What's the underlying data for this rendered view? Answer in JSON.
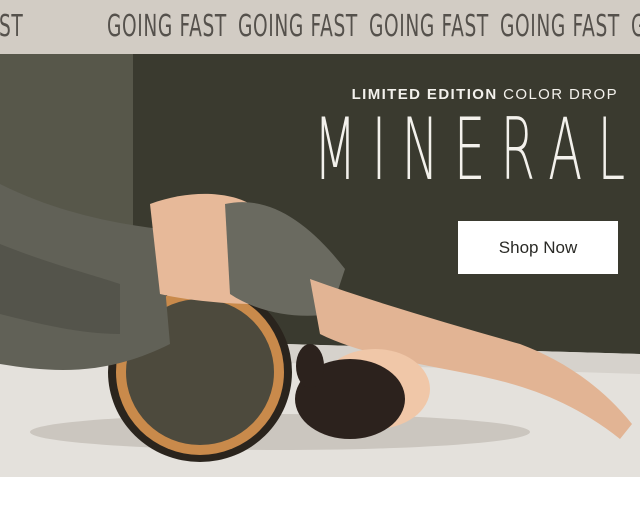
{
  "ticker": {
    "items": [
      "FAST",
      "GOING FAST",
      "GOING FAST",
      "GOING FAST",
      "GOING FAST",
      "GOING FAST"
    ]
  },
  "hero": {
    "eyebrow_bold": "LIMITED EDITION",
    "eyebrow_light": "COLOR DROP",
    "product_name": "MINERAL",
    "cta_label": "Shop Now"
  },
  "colors": {
    "ticker_bg": "#d2ccc4",
    "ticker_text": "#55514c",
    "hero_bg": "#3f3f33",
    "cta_bg": "#ffffff"
  }
}
